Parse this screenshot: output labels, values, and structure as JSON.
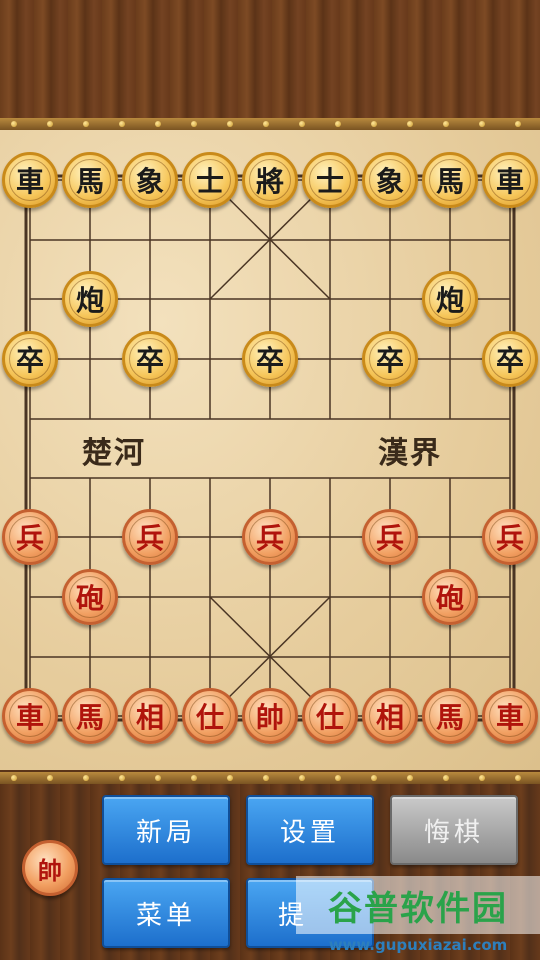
{
  "board": {
    "river_left": "楚河",
    "river_right": "漢界"
  },
  "pieces": {
    "black_back": [
      "車",
      "馬",
      "象",
      "士",
      "將",
      "士",
      "象",
      "馬",
      "車"
    ],
    "black_cannon": [
      "炮",
      "炮"
    ],
    "black_pawns": [
      "卒",
      "卒",
      "卒",
      "卒",
      "卒"
    ],
    "red_pawns": [
      "兵",
      "兵",
      "兵",
      "兵",
      "兵"
    ],
    "red_cannon": [
      "砲",
      "砲"
    ],
    "red_back": [
      "車",
      "馬",
      "相",
      "仕",
      "帥",
      "仕",
      "相",
      "馬",
      "車"
    ]
  },
  "controls": {
    "turn_indicator": "帥",
    "new_game": "新局",
    "settings": "设置",
    "undo": "悔棋",
    "menu": "菜单",
    "hint_partial": "提"
  },
  "watermark": {
    "logo": "谷普软件园",
    "url": "www.gupuxiazai.com"
  },
  "colors": {
    "black_piece_text": "#1b1b1b",
    "red_piece_text": "#b0140c",
    "button_blue": "#1d6fcc",
    "button_disabled": "#8a8a8a"
  }
}
